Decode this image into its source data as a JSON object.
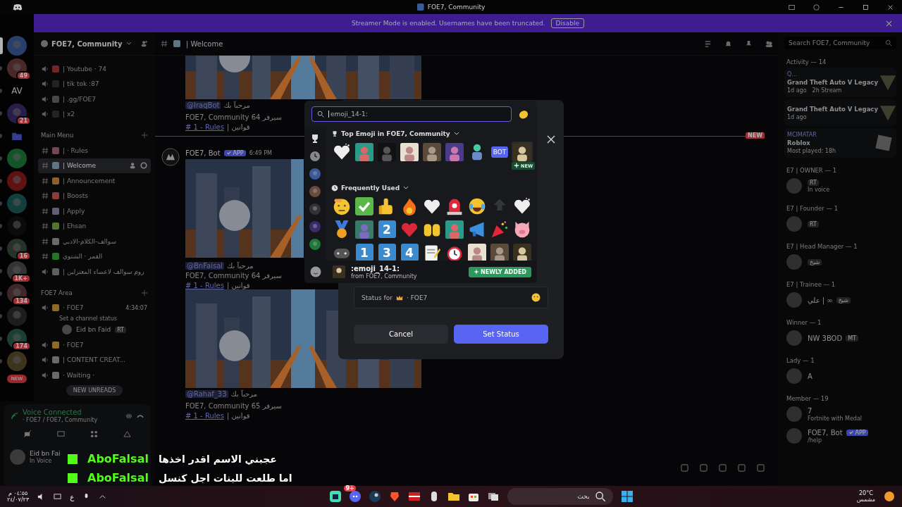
{
  "window": {
    "title": "FOE7, Community"
  },
  "banner": {
    "text": "Streamer Mode is enabled. Usernames have been truncated.",
    "button": "Disable"
  },
  "servers": [
    {
      "kind": "icon",
      "selected": true
    },
    {
      "kind": "icon",
      "selected": false,
      "badge": "49"
    },
    {
      "kind": "text",
      "selected": false,
      "label": "AV"
    },
    {
      "kind": "icon",
      "selected": false,
      "badge": "21"
    },
    {
      "kind": "folder",
      "selected": false
    },
    {
      "kind": "icon",
      "selected": false
    },
    {
      "kind": "icon",
      "selected": false
    },
    {
      "kind": "icon",
      "selected": false
    },
    {
      "kind": "icon",
      "selected": false
    },
    {
      "kind": "icon",
      "selected": false,
      "badge": "16"
    },
    {
      "kind": "icon",
      "selected": false,
      "badge": "1K+"
    },
    {
      "kind": "icon",
      "selected": false,
      "badge": "134"
    },
    {
      "kind": "icon",
      "selected": false
    },
    {
      "kind": "icon",
      "selected": false,
      "badge": "174"
    },
    {
      "kind": "icon",
      "selected": false
    }
  ],
  "new_button": "NEW",
  "server_header": {
    "name": "FOE7, Community"
  },
  "channels": [
    {
      "kind": "voice",
      "label": "| Youtube · 74",
      "selected": false
    },
    {
      "kind": "voice",
      "label": "| tik tok :87",
      "selected": false
    },
    {
      "kind": "voice",
      "label": "| .gg/FOE7",
      "selected": false
    },
    {
      "kind": "voice",
      "label": "| x2",
      "selected": false
    },
    {
      "kind": "category",
      "label": "Main Menu"
    },
    {
      "kind": "text",
      "label": "| · Rules",
      "selected": false
    },
    {
      "kind": "text",
      "label": "| Welcome",
      "selected": true
    },
    {
      "kind": "text",
      "label": "| Announcement",
      "selected": false
    },
    {
      "kind": "text",
      "label": "| Boosts",
      "selected": false
    },
    {
      "kind": "text",
      "label": "| Apply",
      "selected": false
    },
    {
      "kind": "text",
      "label": "| Ehsan",
      "selected": false
    },
    {
      "kind": "text",
      "label": "سوالف-الكلام-الادبي",
      "selected": false
    },
    {
      "kind": "text",
      "label": "القمر · الشتوي",
      "selected": false
    },
    {
      "kind": "voice",
      "label": "| روم سوالف لاعضاء المعتزلين",
      "selected": false
    },
    {
      "kind": "category",
      "label": "FOE7 Area"
    },
    {
      "kind": "voice",
      "label": "· FOE7",
      "selected": false,
      "timer": "4:34:07",
      "status": "Set a channel status",
      "members": [
        {
          "name": "Eid bn Faid",
          "tag": "RT"
        }
      ]
    },
    {
      "kind": "voice",
      "label": "· FOE7",
      "selected": false
    },
    {
      "kind": "voice",
      "label": "| CONTENT CREAT...",
      "selected": false
    },
    {
      "kind": "voice",
      "label": "· Waiting ·",
      "selected": false
    }
  ],
  "new_unreads": "NEW UNREADS",
  "voice_panel": {
    "title": "Voice Connected",
    "subtitle": "· FOE7 / FOE7, Community"
  },
  "user": {
    "name": "Eid bn Fai",
    "status": "In Voice"
  },
  "chat": {
    "channel": "| Welcome",
    "new_divider": "NEW",
    "messages": [
      {
        "mention": "@IraqBot",
        "greeting": "مرحبآ بك",
        "server_line": "FOE7, Community 64 سيرفر",
        "rules_link": "# 1 - Rules",
        "rules_suffix": "| قوانين"
      },
      {
        "author": "FOE7, Bot",
        "badge": "APP",
        "time": "6:49 PM",
        "mention": "@BnFaisal",
        "greeting": "مرحبآ بك",
        "server_line": "FOE7, Community 64 سيرفر",
        "rules_link": "# 1 - Rules",
        "rules_suffix": "| قوانين"
      },
      {
        "mention": "@Rahaf_33",
        "greeting": "مرحبآ بك",
        "server_line": "FOE7, Community 65 سيرفر",
        "rules_link": "# 1 - Rules",
        "rules_suffix": "| قوانين"
      }
    ]
  },
  "members_panel": {
    "search_placeholder": "Search FOE7, Community",
    "activity_title": "Activity — 14",
    "activities": [
      {
        "user": "Q...",
        "game": "Grand Theft Auto V Legacy",
        "time": "1d ago",
        "extra": "2h Stream"
      },
      {
        "game": "Grand Theft Auto V Legacy",
        "time": "1d ago"
      },
      {
        "user": "MCIMATAR",
        "game": "Roblox",
        "time": "Most played: 18h"
      }
    ],
    "groups": [
      {
        "title": "E7 | OWNER — 1",
        "members": [
          {
            "tag": "RT",
            "sub": "In voice"
          }
        ]
      },
      {
        "title": "E7 | Founder — 1",
        "members": [
          {
            "tag": "RT"
          }
        ]
      },
      {
        "title": "E7 | Head Manager — 1",
        "members": [
          {
            "tag": "شيخ"
          }
        ]
      },
      {
        "title": "E7 | Trainee — 1",
        "members": [
          {
            "name": "علي | ∞",
            "tag": "شيخ"
          }
        ]
      },
      {
        "title": "Winner — 1",
        "members": [
          {
            "name": "NW 3BOD",
            "tag": "MT"
          }
        ]
      },
      {
        "title": "Lady — 1",
        "members": [
          {
            "name": "A"
          }
        ]
      },
      {
        "title": "Member — 19",
        "members": [
          {
            "name": "7",
            "sub": "Fortnite with Medal"
          },
          {
            "name": "FOE7, Bot",
            "badge": "APP",
            "sub": "/help"
          }
        ]
      }
    ]
  },
  "status_dialog": {
    "placeholder_prefix": "Status for",
    "placeholder_suffix": "· FOE7",
    "cancel": "Cancel",
    "submit": "Set Status"
  },
  "emoji_picker": {
    "search_placeholder": "emoji_14-1:",
    "top_title": "Top Emoji in FOE7, Community",
    "frequent_title": "Frequently Used",
    "bot_label": "BOT",
    "new_label": "NEW",
    "keycaps": [
      "2",
      "1",
      "3",
      "4"
    ],
    "preview": {
      "name": ":emoji_14-1:",
      "source": "from FOE7, Community",
      "badge": "NEWLY ADDED"
    }
  },
  "subtitles": [
    {
      "user": "AboFalsal",
      "text": "عجبني الاسم اقدر اخذها"
    },
    {
      "user": "AboFalsal",
      "text": "اما طلعت للبنات اجل كنسل"
    }
  ],
  "taskbar": {
    "time": "٠٤:٥٥ م",
    "date": "٢٤/٠٧/٢٣",
    "language": "ع",
    "search_placeholder": "بحث",
    "discord_badge": "9+",
    "weather_temp": "20°C",
    "weather_desc": "مشمس"
  }
}
